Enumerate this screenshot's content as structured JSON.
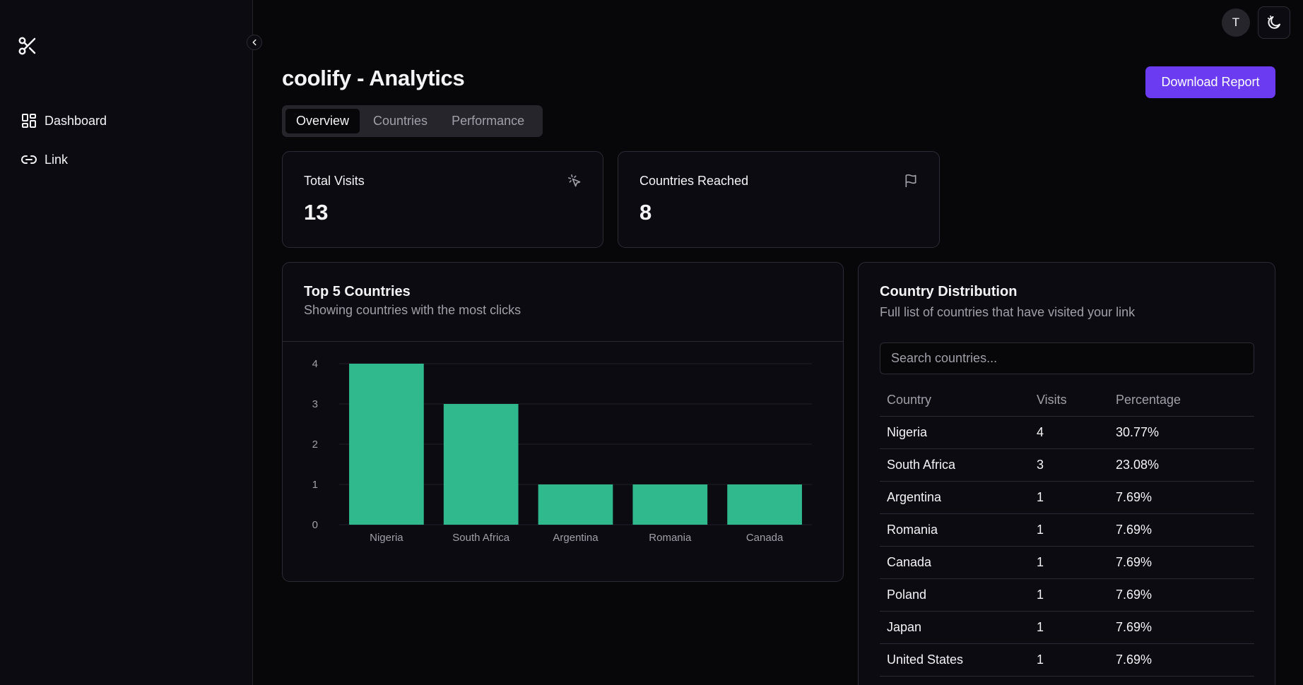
{
  "sidebar": {
    "items": [
      {
        "label": "Dashboard",
        "icon": "dashboard-icon"
      },
      {
        "label": "Link",
        "icon": "link-icon"
      }
    ]
  },
  "topbar": {
    "avatar_initial": "T"
  },
  "page": {
    "title": "coolify - Analytics",
    "download_label": "Download Report",
    "tabs": [
      {
        "label": "Overview",
        "active": true
      },
      {
        "label": "Countries",
        "active": false
      },
      {
        "label": "Performance",
        "active": false
      }
    ]
  },
  "stats": [
    {
      "title": "Total Visits",
      "value": "13",
      "icon": "cursor-click-icon"
    },
    {
      "title": "Countries Reached",
      "value": "8",
      "icon": "flag-icon"
    }
  ],
  "top_countries": {
    "title": "Top 5 Countries",
    "subtitle": "Showing countries with the most clicks"
  },
  "chart_data": {
    "type": "bar",
    "categories": [
      "Nigeria",
      "South Africa",
      "Argentina",
      "Romania",
      "Canada"
    ],
    "values": [
      4,
      3,
      1,
      1,
      1
    ],
    "title": "Top 5 Countries",
    "subtitle": "Showing countries with the most clicks",
    "xlabel": "",
    "ylabel": "",
    "ylim": [
      0,
      4
    ],
    "yticks": [
      0,
      1,
      2,
      3,
      4
    ],
    "grid": true,
    "color": "#2fb98c"
  },
  "distribution": {
    "title": "Country Distribution",
    "subtitle": "Full list of countries that have visited your link",
    "search_placeholder": "Search countries...",
    "columns": [
      "Country",
      "Visits",
      "Percentage"
    ],
    "rows": [
      [
        "Nigeria",
        "4",
        "30.77%"
      ],
      [
        "South Africa",
        "3",
        "23.08%"
      ],
      [
        "Argentina",
        "1",
        "7.69%"
      ],
      [
        "Romania",
        "1",
        "7.69%"
      ],
      [
        "Canada",
        "1",
        "7.69%"
      ],
      [
        "Poland",
        "1",
        "7.69%"
      ],
      [
        "Japan",
        "1",
        "7.69%"
      ],
      [
        "United States",
        "1",
        "7.69%"
      ]
    ]
  },
  "colors": {
    "accent": "#6b3bf2",
    "bar": "#2fb98c",
    "background": "#070609",
    "card": "#0c0b12",
    "border": "#2c2a34",
    "muted_text": "#a19fa8"
  }
}
